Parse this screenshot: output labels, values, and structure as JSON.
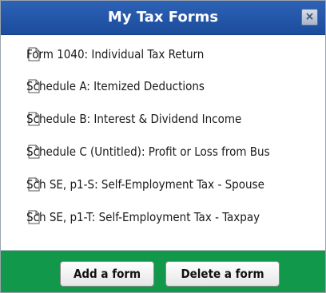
{
  "window": {
    "title": "My Tax Forms",
    "close_label": "×"
  },
  "forms": [
    {
      "label": "Form 1040: Individual Tax Return"
    },
    {
      "label": "Schedule A: Itemized Deductions"
    },
    {
      "label": "Schedule B: Interest & Dividend Income"
    },
    {
      "label": "Schedule C (Untitled): Profit or Loss from Bus"
    },
    {
      "label": "Sch SE, p1-S: Self-Employment Tax - Spouse"
    },
    {
      "label": "Sch SE, p1-T: Self-Employment Tax - Taxpay"
    }
  ],
  "footer": {
    "add_label": "Add a form",
    "delete_label": "Delete a form"
  },
  "colors": {
    "titlebar": "#1c4c9c",
    "footer": "#12984b"
  },
  "icons": {
    "form_item": "document-icon",
    "close": "close-icon"
  }
}
